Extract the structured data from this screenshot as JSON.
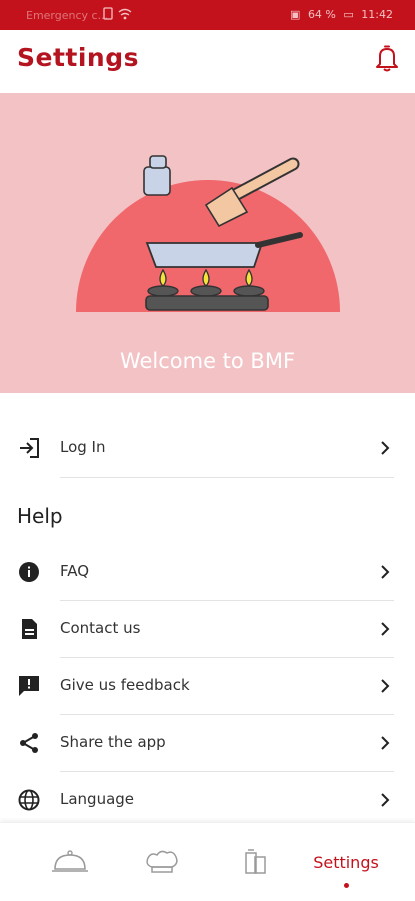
{
  "status_bar": {
    "carrier": "Emergency c...",
    "battery_percent": "64 %",
    "time": "11:42"
  },
  "header": {
    "title": "Settings",
    "notification_icon": "bell-icon"
  },
  "hero": {
    "welcome_text": "Welcome to BMF",
    "background_color": "#f2c2c5",
    "circle_color": "#f0676c"
  },
  "account": {
    "login_label": "Log In"
  },
  "help": {
    "section_title": "Help",
    "items": [
      {
        "label": "FAQ",
        "icon": "info-icon"
      },
      {
        "label": "Contact us",
        "icon": "document-icon"
      },
      {
        "label": "Give us feedback",
        "icon": "feedback-icon"
      },
      {
        "label": "Share the app",
        "icon": "share-icon"
      },
      {
        "label": "Language",
        "icon": "globe-icon"
      }
    ]
  },
  "bottom_nav": {
    "items": [
      {
        "name": "cloche",
        "icon": "cloche-icon"
      },
      {
        "name": "chef-hat",
        "icon": "chef-hat-icon"
      },
      {
        "name": "drinks",
        "icon": "drink-icon"
      },
      {
        "name": "settings",
        "label": "Settings",
        "active": true
      }
    ]
  },
  "colors": {
    "brand": "#c4121d",
    "title": "#b4141f"
  }
}
